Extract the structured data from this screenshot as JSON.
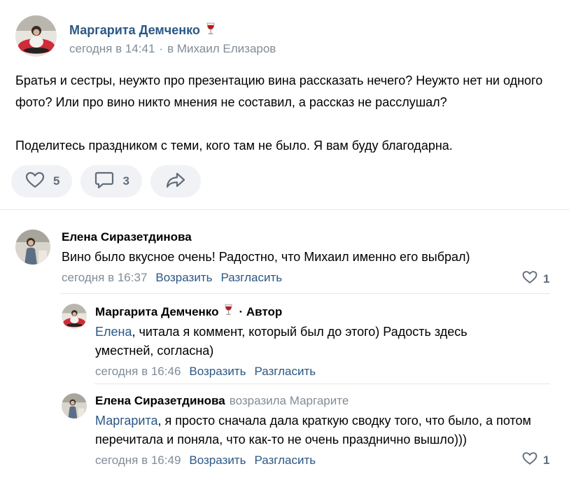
{
  "post": {
    "author": "Маргарита Демченко",
    "author_emoji": "wine-glass-icon",
    "date": "сегодня в 14:41",
    "separator": "·",
    "location": "в Михаил Елизаров",
    "text_line1": "Братья и сестры, неужто про презентацию вина рассказать нечего? Неужто нет ни одного фото? Или про вино никто мнения не составил, а рассказ не расслушал?",
    "text_line2": "Поделитесь праздником с теми, кого там не было. Я вам буду благодарна.",
    "likes": "5",
    "comments": "3"
  },
  "comments": [
    {
      "author": "Елена Сиразетдинова",
      "text": "Вино было вкусное очень! Радостно, что Михаил именно его выбрал)",
      "date": "сегодня в 16:37",
      "reply_label": "Возразить",
      "share_label": "Разгласить",
      "likes": "1"
    },
    {
      "author": "Маргарита Демченко",
      "author_emoji": "wine-glass-icon",
      "badge": "· Автор",
      "mention": "Елена",
      "text": ", читала я коммент, который был до этого) Радость здесь уместней, согласна)",
      "date": "сегодня в 16:46",
      "reply_label": "Возразить",
      "share_label": "Разгласить"
    },
    {
      "author": "Елена Сиразетдинова",
      "reply_to": "возразила Маргарите",
      "mention": "Маргарита",
      "text": ", я просто сначала дала краткую сводку того, что было, а потом перечитала и поняла, что как-то не очень празднично вышло)))",
      "date": "сегодня в 16:49",
      "reply_label": "Возразить",
      "share_label": "Разгласить",
      "likes": "1"
    }
  ],
  "colors": {
    "link": "#2a5885",
    "muted": "#818c99",
    "button_bg": "#f0f2f5",
    "icon": "#626d7a"
  }
}
